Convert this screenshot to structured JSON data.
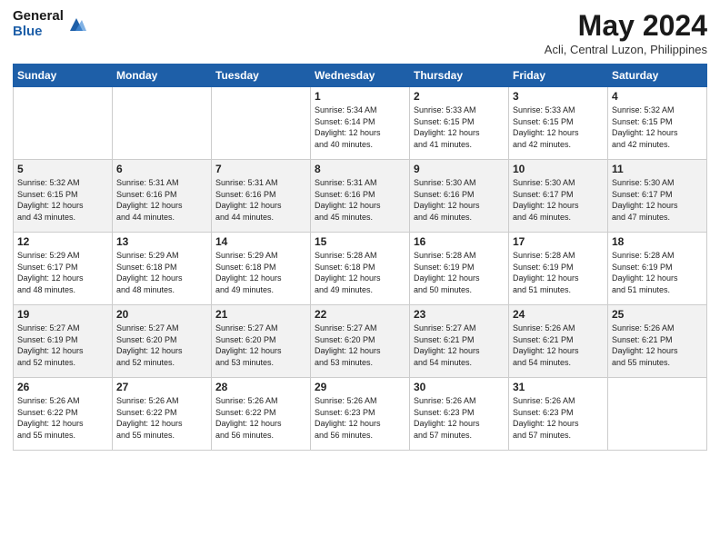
{
  "header": {
    "logo_general": "General",
    "logo_blue": "Blue",
    "month_title": "May 2024",
    "location": "Acli, Central Luzon, Philippines"
  },
  "weekdays": [
    "Sunday",
    "Monday",
    "Tuesday",
    "Wednesday",
    "Thursday",
    "Friday",
    "Saturday"
  ],
  "weeks": [
    [
      {
        "day": "",
        "info": ""
      },
      {
        "day": "",
        "info": ""
      },
      {
        "day": "",
        "info": ""
      },
      {
        "day": "1",
        "info": "Sunrise: 5:34 AM\nSunset: 6:14 PM\nDaylight: 12 hours\nand 40 minutes."
      },
      {
        "day": "2",
        "info": "Sunrise: 5:33 AM\nSunset: 6:15 PM\nDaylight: 12 hours\nand 41 minutes."
      },
      {
        "day": "3",
        "info": "Sunrise: 5:33 AM\nSunset: 6:15 PM\nDaylight: 12 hours\nand 42 minutes."
      },
      {
        "day": "4",
        "info": "Sunrise: 5:32 AM\nSunset: 6:15 PM\nDaylight: 12 hours\nand 42 minutes."
      }
    ],
    [
      {
        "day": "5",
        "info": "Sunrise: 5:32 AM\nSunset: 6:15 PM\nDaylight: 12 hours\nand 43 minutes."
      },
      {
        "day": "6",
        "info": "Sunrise: 5:31 AM\nSunset: 6:16 PM\nDaylight: 12 hours\nand 44 minutes."
      },
      {
        "day": "7",
        "info": "Sunrise: 5:31 AM\nSunset: 6:16 PM\nDaylight: 12 hours\nand 44 minutes."
      },
      {
        "day": "8",
        "info": "Sunrise: 5:31 AM\nSunset: 6:16 PM\nDaylight: 12 hours\nand 45 minutes."
      },
      {
        "day": "9",
        "info": "Sunrise: 5:30 AM\nSunset: 6:16 PM\nDaylight: 12 hours\nand 46 minutes."
      },
      {
        "day": "10",
        "info": "Sunrise: 5:30 AM\nSunset: 6:17 PM\nDaylight: 12 hours\nand 46 minutes."
      },
      {
        "day": "11",
        "info": "Sunrise: 5:30 AM\nSunset: 6:17 PM\nDaylight: 12 hours\nand 47 minutes."
      }
    ],
    [
      {
        "day": "12",
        "info": "Sunrise: 5:29 AM\nSunset: 6:17 PM\nDaylight: 12 hours\nand 48 minutes."
      },
      {
        "day": "13",
        "info": "Sunrise: 5:29 AM\nSunset: 6:18 PM\nDaylight: 12 hours\nand 48 minutes."
      },
      {
        "day": "14",
        "info": "Sunrise: 5:29 AM\nSunset: 6:18 PM\nDaylight: 12 hours\nand 49 minutes."
      },
      {
        "day": "15",
        "info": "Sunrise: 5:28 AM\nSunset: 6:18 PM\nDaylight: 12 hours\nand 49 minutes."
      },
      {
        "day": "16",
        "info": "Sunrise: 5:28 AM\nSunset: 6:19 PM\nDaylight: 12 hours\nand 50 minutes."
      },
      {
        "day": "17",
        "info": "Sunrise: 5:28 AM\nSunset: 6:19 PM\nDaylight: 12 hours\nand 51 minutes."
      },
      {
        "day": "18",
        "info": "Sunrise: 5:28 AM\nSunset: 6:19 PM\nDaylight: 12 hours\nand 51 minutes."
      }
    ],
    [
      {
        "day": "19",
        "info": "Sunrise: 5:27 AM\nSunset: 6:19 PM\nDaylight: 12 hours\nand 52 minutes."
      },
      {
        "day": "20",
        "info": "Sunrise: 5:27 AM\nSunset: 6:20 PM\nDaylight: 12 hours\nand 52 minutes."
      },
      {
        "day": "21",
        "info": "Sunrise: 5:27 AM\nSunset: 6:20 PM\nDaylight: 12 hours\nand 53 minutes."
      },
      {
        "day": "22",
        "info": "Sunrise: 5:27 AM\nSunset: 6:20 PM\nDaylight: 12 hours\nand 53 minutes."
      },
      {
        "day": "23",
        "info": "Sunrise: 5:27 AM\nSunset: 6:21 PM\nDaylight: 12 hours\nand 54 minutes."
      },
      {
        "day": "24",
        "info": "Sunrise: 5:26 AM\nSunset: 6:21 PM\nDaylight: 12 hours\nand 54 minutes."
      },
      {
        "day": "25",
        "info": "Sunrise: 5:26 AM\nSunset: 6:21 PM\nDaylight: 12 hours\nand 55 minutes."
      }
    ],
    [
      {
        "day": "26",
        "info": "Sunrise: 5:26 AM\nSunset: 6:22 PM\nDaylight: 12 hours\nand 55 minutes."
      },
      {
        "day": "27",
        "info": "Sunrise: 5:26 AM\nSunset: 6:22 PM\nDaylight: 12 hours\nand 55 minutes."
      },
      {
        "day": "28",
        "info": "Sunrise: 5:26 AM\nSunset: 6:22 PM\nDaylight: 12 hours\nand 56 minutes."
      },
      {
        "day": "29",
        "info": "Sunrise: 5:26 AM\nSunset: 6:23 PM\nDaylight: 12 hours\nand 56 minutes."
      },
      {
        "day": "30",
        "info": "Sunrise: 5:26 AM\nSunset: 6:23 PM\nDaylight: 12 hours\nand 57 minutes."
      },
      {
        "day": "31",
        "info": "Sunrise: 5:26 AM\nSunset: 6:23 PM\nDaylight: 12 hours\nand 57 minutes."
      },
      {
        "day": "",
        "info": ""
      }
    ]
  ]
}
